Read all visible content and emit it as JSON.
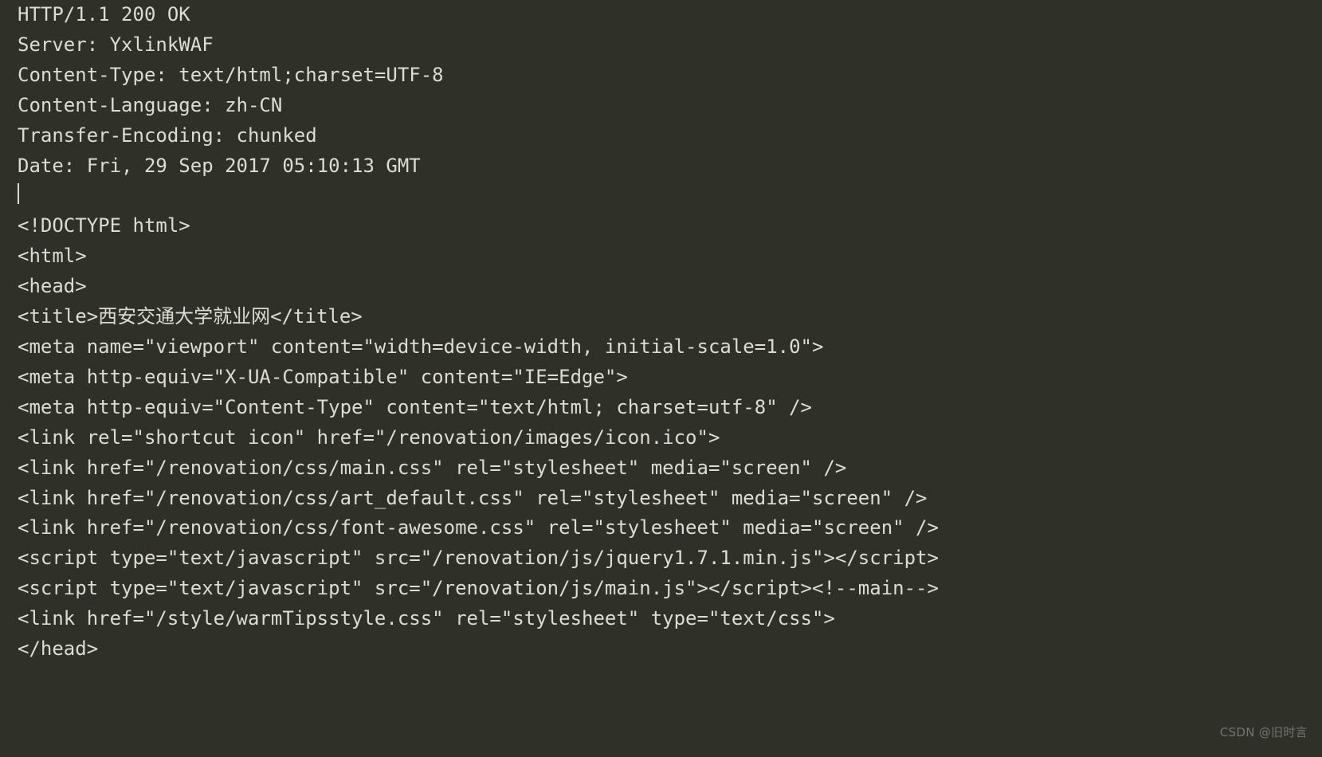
{
  "lines": {
    "l1": "HTTP/1.1 200 OK",
    "l2": "Server: YxlinkWAF",
    "l3": "Content-Type: text/html;charset=UTF-8",
    "l4": "Content-Language: zh-CN",
    "l5": "Transfer-Encoding: chunked",
    "l6": "Date: Fri, 29 Sep 2017 05:10:13 GMT",
    "l7": "",
    "l8": "<!DOCTYPE html>",
    "l9": "<html>",
    "l10": "<head>",
    "l11": "<title>西安交通大学就业网</title>",
    "l12": "<meta name=\"viewport\" content=\"width=device-width, initial-scale=1.0\">",
    "l13": "<meta http-equiv=\"X-UA-Compatible\" content=\"IE=Edge\">",
    "l14": "<meta http-equiv=\"Content-Type\" content=\"text/html; charset=utf-8\" />",
    "l15": "<link rel=\"shortcut icon\" href=\"/renovation/images/icon.ico\">",
    "l16": "<link href=\"/renovation/css/main.css\" rel=\"stylesheet\" media=\"screen\" />",
    "l17": "<link href=\"/renovation/css/art_default.css\" rel=\"stylesheet\" media=\"screen\" />",
    "l18": "<link href=\"/renovation/css/font-awesome.css\" rel=\"stylesheet\" media=\"screen\" />",
    "l19": "<script type=\"text/javascript\" src=\"/renovation/js/jquery1.7.1.min.js\"></script>",
    "l20": "<script type=\"text/javascript\" src=\"/renovation/js/main.js\"></script><!--main-->",
    "l21": "<link href=\"/style/warmTipsstyle.css\" rel=\"stylesheet\" type=\"text/css\">",
    "l22": "</head>"
  },
  "watermark": "CSDN @旧时言"
}
